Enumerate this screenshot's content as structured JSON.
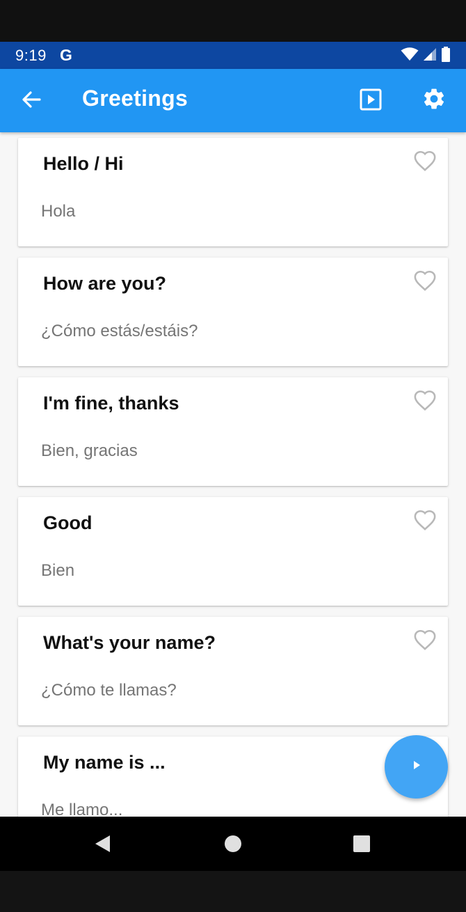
{
  "status_bar": {
    "time": "9:19",
    "app_indicator": "G",
    "icons": [
      "wifi-icon",
      "cell-signal-icon",
      "battery-icon"
    ]
  },
  "app_bar": {
    "title": "Greetings",
    "back_icon": "arrow-back-icon",
    "actions": [
      "slideshow-icon",
      "settings-icon"
    ],
    "color": "#2196f3"
  },
  "cards": [
    {
      "phrase": "Hello / Hi",
      "translation": "Hola",
      "favorite": false
    },
    {
      "phrase": "How are you?",
      "translation": "¿Cómo estás/estáis?",
      "favorite": false
    },
    {
      "phrase": "I'm fine, thanks",
      "translation": "Bien, gracias",
      "favorite": false
    },
    {
      "phrase": "Good",
      "translation": "Bien",
      "favorite": false
    },
    {
      "phrase": "What's your name?",
      "translation": "¿Cómo te llamas?",
      "favorite": false
    },
    {
      "phrase": "My name is ...",
      "translation": "Me llamo...",
      "favorite": false
    }
  ],
  "fab": {
    "icon": "play-icon",
    "color": "#42a5f5"
  },
  "nav_bar": {
    "buttons": [
      "nav-back-icon",
      "nav-home-icon",
      "nav-recents-icon"
    ]
  }
}
